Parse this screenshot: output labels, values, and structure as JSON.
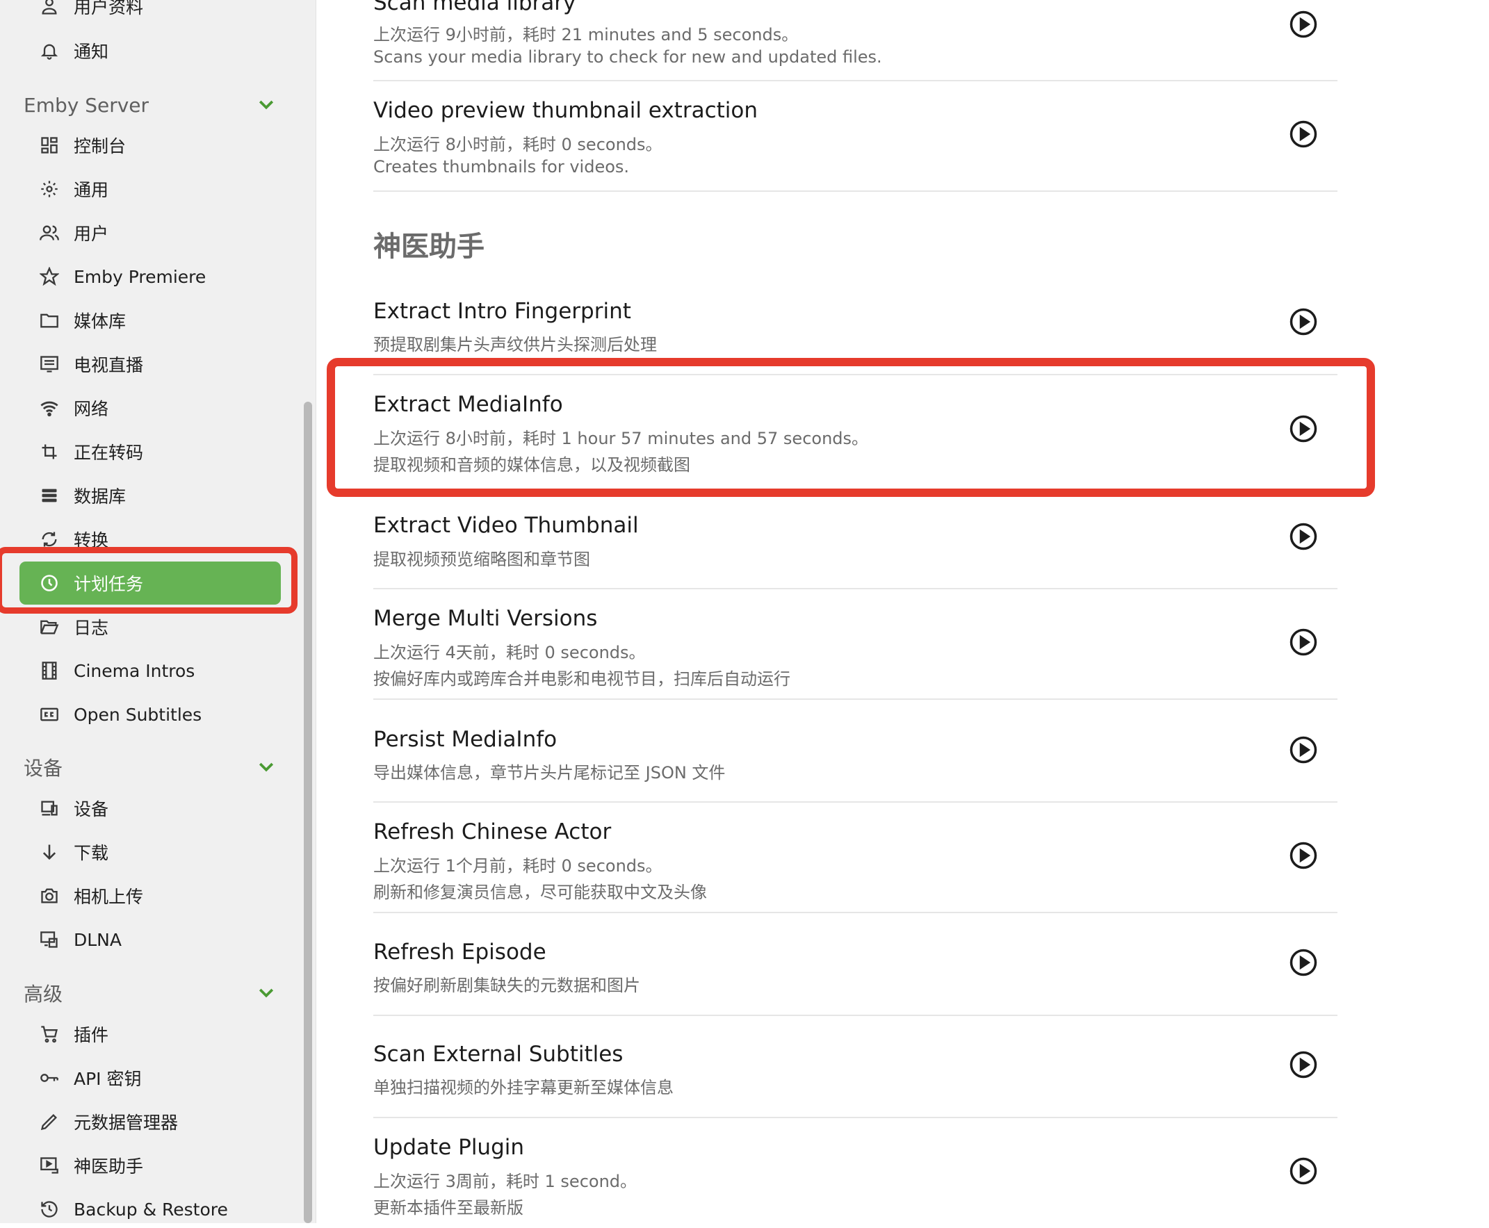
{
  "sidebar": {
    "top_items": [
      {
        "label": "用户资料",
        "icon": "user-icon"
      },
      {
        "label": "通知",
        "icon": "bell-icon"
      }
    ],
    "sections": [
      {
        "title": "Emby Server",
        "items": [
          {
            "label": "控制台",
            "icon": "dashboard-icon"
          },
          {
            "label": "通用",
            "icon": "gear-icon"
          },
          {
            "label": "用户",
            "icon": "users-icon"
          },
          {
            "label": "Emby Premiere",
            "icon": "star-icon"
          },
          {
            "label": "媒体库",
            "icon": "folder-icon"
          },
          {
            "label": "电视直播",
            "icon": "tv-guide-icon"
          },
          {
            "label": "网络",
            "icon": "wifi-icon"
          },
          {
            "label": "正在转码",
            "icon": "transcode-icon"
          },
          {
            "label": "数据库",
            "icon": "database-icon"
          },
          {
            "label": "转换",
            "icon": "convert-icon"
          },
          {
            "label": "计划任务",
            "icon": "clock-icon",
            "active": true
          },
          {
            "label": "日志",
            "icon": "open-folder-icon"
          },
          {
            "label": "Cinema Intros",
            "icon": "film-icon"
          },
          {
            "label": "Open Subtitles",
            "icon": "closed-caption-icon"
          }
        ]
      },
      {
        "title": "设备",
        "items": [
          {
            "label": "设备",
            "icon": "devices-icon"
          },
          {
            "label": "下载",
            "icon": "download-arrow-icon"
          },
          {
            "label": "相机上传",
            "icon": "camera-icon"
          },
          {
            "label": "DLNA",
            "icon": "dlna-icon"
          }
        ]
      },
      {
        "title": "高级",
        "items": [
          {
            "label": "插件",
            "icon": "cart-icon"
          },
          {
            "label": "API 密钥",
            "icon": "key-icon"
          },
          {
            "label": "元数据管理器",
            "icon": "pencil-icon"
          },
          {
            "label": "神医助手",
            "icon": "video-plugin-icon"
          },
          {
            "label": "Backup & Restore",
            "icon": "restore-icon"
          }
        ]
      }
    ]
  },
  "main": {
    "section_title": "神医助手",
    "tasks_before": [
      {
        "title": "Scan media library",
        "line1": "上次运行 9小时前，耗时 21 minutes and 5 seconds。",
        "line2": "Scans your media library to check for new and updated files."
      },
      {
        "title": "Video preview thumbnail extraction",
        "line1": "上次运行 8小时前，耗时 0 seconds。",
        "line2": "Creates thumbnails for videos."
      }
    ],
    "tasks": [
      {
        "title": "Extract Intro Fingerprint",
        "line1": "预提取剧集片头声纹供片头探测后处理",
        "line2": ""
      },
      {
        "title": "Extract MediaInfo",
        "line1": "上次运行 8小时前，耗时 1 hour 57 minutes and 57 seconds。",
        "line2": "提取视频和音频的媒体信息，以及视频截图"
      },
      {
        "title": "Extract Video Thumbnail",
        "line1": "提取视频预览缩略图和章节图",
        "line2": ""
      },
      {
        "title": "Merge Multi Versions",
        "line1": "上次运行 4天前，耗时 0 seconds。",
        "line2": "按偏好库内或跨库合并电影和电视节目，扫库后自动运行"
      },
      {
        "title": "Persist MediaInfo",
        "line1": "导出媒体信息，章节片头片尾标记至 JSON 文件",
        "line2": ""
      },
      {
        "title": "Refresh Chinese Actor",
        "line1": "上次运行 1个月前，耗时 0 seconds。",
        "line2": "刷新和修复演员信息，尽可能获取中文及头像"
      },
      {
        "title": "Refresh Episode",
        "line1": "按偏好刷新剧集缺失的元数据和图片",
        "line2": ""
      },
      {
        "title": "Scan External Subtitles",
        "line1": "单独扫描视频的外挂字幕更新至媒体信息",
        "line2": ""
      },
      {
        "title": "Update Plugin",
        "line1": "上次运行 3周前，耗时 1 second。",
        "line2": "更新本插件至最新版"
      }
    ]
  },
  "colors": {
    "accent_green": "#66b354",
    "highlight_red": "#e63b2c",
    "chevron_green": "#4a9a33"
  }
}
